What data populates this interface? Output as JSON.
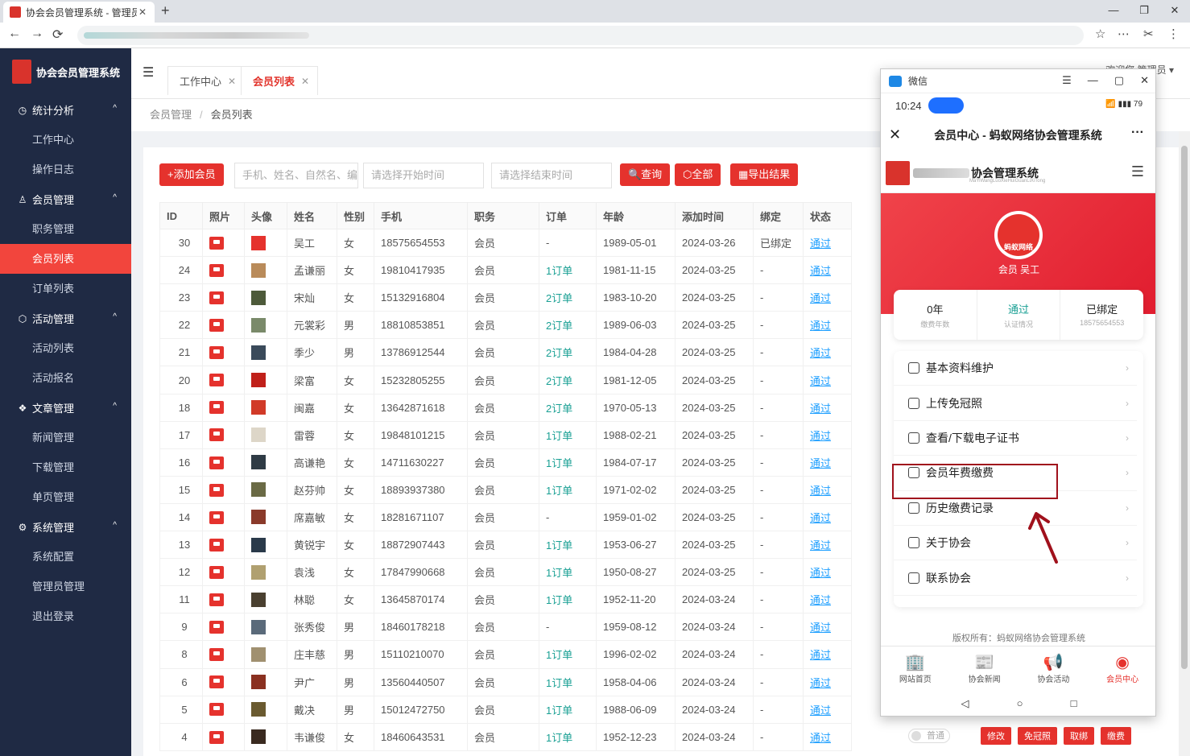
{
  "browser": {
    "tab_title": "协会会员管理系统 - 管理员后",
    "tab_close": "✕",
    "new_tab": "+",
    "window_controls": [
      "—",
      "❐",
      "✕"
    ],
    "nav": [
      "←",
      "→",
      "⟳"
    ],
    "tools": [
      "☆",
      "⋯",
      "✂",
      "⋮"
    ]
  },
  "sidebar": {
    "title": "协会会员管理系统",
    "groups": [
      {
        "label": "统计分析",
        "icon": "◷",
        "items": [
          "工作中心",
          "操作日志"
        ]
      },
      {
        "label": "会员管理",
        "icon": "♙",
        "items": [
          "职务管理",
          "会员列表",
          "订单列表"
        ]
      },
      {
        "label": "活动管理",
        "icon": "⬡",
        "items": [
          "活动列表",
          "活动报名"
        ]
      },
      {
        "label": "文章管理",
        "icon": "❖",
        "items": [
          "新闻管理",
          "下载管理",
          "单页管理"
        ]
      },
      {
        "label": "系统管理",
        "icon": "⚙",
        "items": [
          "系统配置",
          "管理员管理",
          "退出登录"
        ]
      }
    ],
    "caret": "^",
    "active_item": "会员列表"
  },
  "header": {
    "toggle": "☰",
    "tabs": [
      {
        "label": "工作中心",
        "close": "✕"
      },
      {
        "label": "会员列表",
        "close": "✕"
      }
    ],
    "right_text": "欢迎您 管理员 ▾"
  },
  "breadcrumb": {
    "root": "会员管理",
    "sep": "/",
    "current": "会员列表"
  },
  "toolbar": {
    "add_label": "+添加会员",
    "keyword_placeholder": "手机、姓名、自然名、编号",
    "start_placeholder": "请选择开始时间",
    "end_placeholder": "请选择结束时间",
    "query_label": "🔍查询",
    "all_label": "⬡全部",
    "export_label": "▦导出结果"
  },
  "table": {
    "columns": [
      "ID",
      "照片",
      "头像",
      "姓名",
      "性别",
      "手机",
      "职务",
      "订单",
      "年龄",
      "添加时间",
      "绑定",
      "状态"
    ],
    "rows": [
      {
        "id": "30",
        "name": "吴工",
        "gender": "女",
        "phone": "18575654553",
        "role": "会员",
        "order": "-",
        "birth": "1989-05-01",
        "added": "2024-03-26",
        "bind": "已绑定",
        "status": "通过",
        "avatar": "#e5322d"
      },
      {
        "id": "24",
        "name": "孟谦丽",
        "gender": "女",
        "phone": "19810417935",
        "role": "会员",
        "order": "1订单",
        "birth": "1981-11-15",
        "added": "2024-03-25",
        "bind": "-",
        "status": "通过",
        "avatar": "#b98b5a"
      },
      {
        "id": "23",
        "name": "宋灿",
        "gender": "女",
        "phone": "15132916804",
        "role": "会员",
        "order": "2订单",
        "birth": "1983-10-20",
        "added": "2024-03-25",
        "bind": "-",
        "status": "通过",
        "avatar": "#4d5a3a"
      },
      {
        "id": "22",
        "name": "元裳彩",
        "gender": "男",
        "phone": "18810853851",
        "role": "会员",
        "order": "2订单",
        "birth": "1989-06-03",
        "added": "2024-03-25",
        "bind": "-",
        "status": "通过",
        "avatar": "#7a8a6a"
      },
      {
        "id": "21",
        "name": "季少",
        "gender": "男",
        "phone": "13786912544",
        "role": "会员",
        "order": "2订单",
        "birth": "1984-04-28",
        "added": "2024-03-25",
        "bind": "-",
        "status": "通过",
        "avatar": "#3a4a5a"
      },
      {
        "id": "20",
        "name": "梁富",
        "gender": "女",
        "phone": "15232805255",
        "role": "会员",
        "order": "2订单",
        "birth": "1981-12-05",
        "added": "2024-03-25",
        "bind": "-",
        "status": "通过",
        "avatar": "#c0201a"
      },
      {
        "id": "18",
        "name": "闽嘉",
        "gender": "女",
        "phone": "13642871618",
        "role": "会员",
        "order": "2订单",
        "birth": "1970-05-13",
        "added": "2024-03-25",
        "bind": "-",
        "status": "通过",
        "avatar": "#d13a28"
      },
      {
        "id": "17",
        "name": "雷蓉",
        "gender": "女",
        "phone": "19848101215",
        "role": "会员",
        "order": "1订单",
        "birth": "1988-02-21",
        "added": "2024-03-25",
        "bind": "-",
        "status": "通过",
        "avatar": "#ddd6c8"
      },
      {
        "id": "16",
        "name": "高谦艳",
        "gender": "女",
        "phone": "14711630227",
        "role": "会员",
        "order": "1订单",
        "birth": "1984-07-17",
        "added": "2024-03-25",
        "bind": "-",
        "status": "通过",
        "avatar": "#2f3b45"
      },
      {
        "id": "15",
        "name": "赵芬帅",
        "gender": "女",
        "phone": "18893937380",
        "role": "会员",
        "order": "1订单",
        "birth": "1971-02-02",
        "added": "2024-03-25",
        "bind": "-",
        "status": "通过",
        "avatar": "#6a6a45"
      },
      {
        "id": "14",
        "name": "席嘉敏",
        "gender": "女",
        "phone": "18281671107",
        "role": "会员",
        "order": "-",
        "birth": "1959-01-02",
        "added": "2024-03-25",
        "bind": "-",
        "status": "通过",
        "avatar": "#8a3a2a"
      },
      {
        "id": "13",
        "name": "黄锐宇",
        "gender": "女",
        "phone": "18872907443",
        "role": "会员",
        "order": "1订单",
        "birth": "1953-06-27",
        "added": "2024-03-25",
        "bind": "-",
        "status": "通过",
        "avatar": "#2a3a4a"
      },
      {
        "id": "12",
        "name": "袁浅",
        "gender": "女",
        "phone": "17847990668",
        "role": "会员",
        "order": "1订单",
        "birth": "1950-08-27",
        "added": "2024-03-25",
        "bind": "-",
        "status": "通过",
        "avatar": "#b0a070"
      },
      {
        "id": "11",
        "name": "林聪",
        "gender": "女",
        "phone": "13645870174",
        "role": "会员",
        "order": "1订单",
        "birth": "1952-11-20",
        "added": "2024-03-24",
        "bind": "-",
        "status": "通过",
        "avatar": "#4a4030"
      },
      {
        "id": "9",
        "name": "张秀俊",
        "gender": "男",
        "phone": "18460178218",
        "role": "会员",
        "order": "-",
        "birth": "1959-08-12",
        "added": "2024-03-24",
        "bind": "-",
        "status": "通过",
        "avatar": "#5a6a7a"
      },
      {
        "id": "8",
        "name": "庄丰慈",
        "gender": "男",
        "phone": "15110210070",
        "role": "会员",
        "order": "1订单",
        "birth": "1996-02-02",
        "added": "2024-03-24",
        "bind": "-",
        "status": "通过",
        "avatar": "#a09070"
      },
      {
        "id": "6",
        "name": "尹广",
        "gender": "男",
        "phone": "13560440507",
        "role": "会员",
        "order": "1订单",
        "birth": "1958-04-06",
        "added": "2024-03-24",
        "bind": "-",
        "status": "通过",
        "avatar": "#8a3020"
      },
      {
        "id": "5",
        "name": "戴决",
        "gender": "男",
        "phone": "15012472750",
        "role": "会员",
        "order": "1订单",
        "birth": "1988-06-09",
        "added": "2024-03-24",
        "bind": "-",
        "status": "通过",
        "avatar": "#6a5a30"
      },
      {
        "id": "4",
        "name": "韦谦俊",
        "gender": "女",
        "phone": "18460643531",
        "role": "会员",
        "order": "1订单",
        "birth": "1952-12-23",
        "added": "2024-03-24",
        "bind": "-",
        "status": "通过",
        "avatar": "#3a2a20"
      }
    ],
    "row_actions": [
      "修改",
      "免冠照",
      "取绑",
      "缴费"
    ],
    "toggle_label": "普通"
  },
  "wechat": {
    "window_title": "微信",
    "window_controls": [
      "☰",
      "—",
      "▢",
      "✕"
    ],
    "time": "10:24",
    "signal": "📶 ▮▮▮ 79",
    "page_title": "会员中心 - 蚂蚁网络协会管理系统",
    "close": "✕",
    "more": "···",
    "site_name": "协会管理系统",
    "site_sub": "MaYiWangLuoXieHuiGuanLiXiTong",
    "hamburger": "☰",
    "logo_text": "蚂蚁网络",
    "member_name": "会员 吴工",
    "stats": [
      {
        "value": "0年",
        "label": "缴费年数"
      },
      {
        "value": "通过",
        "label": "认证情况"
      },
      {
        "value": "已绑定",
        "label": "18575654553"
      }
    ],
    "menu": [
      "基本资料维护",
      "上传免冠照",
      "查看/下载电子证书",
      "会员年费缴费",
      "历史缴费记录",
      "关于协会",
      "联系协会"
    ],
    "chevron": "›",
    "copyright": "版权所有：蚂蚁网络协会管理系统",
    "tabbar": [
      {
        "label": "网站首页",
        "icon": "🏢"
      },
      {
        "label": "协会新闻",
        "icon": "📰"
      },
      {
        "label": "协会活动",
        "icon": "📢"
      },
      {
        "label": "会员中心",
        "icon": "◉"
      }
    ],
    "navbar": [
      "◁",
      "○",
      "□"
    ]
  }
}
